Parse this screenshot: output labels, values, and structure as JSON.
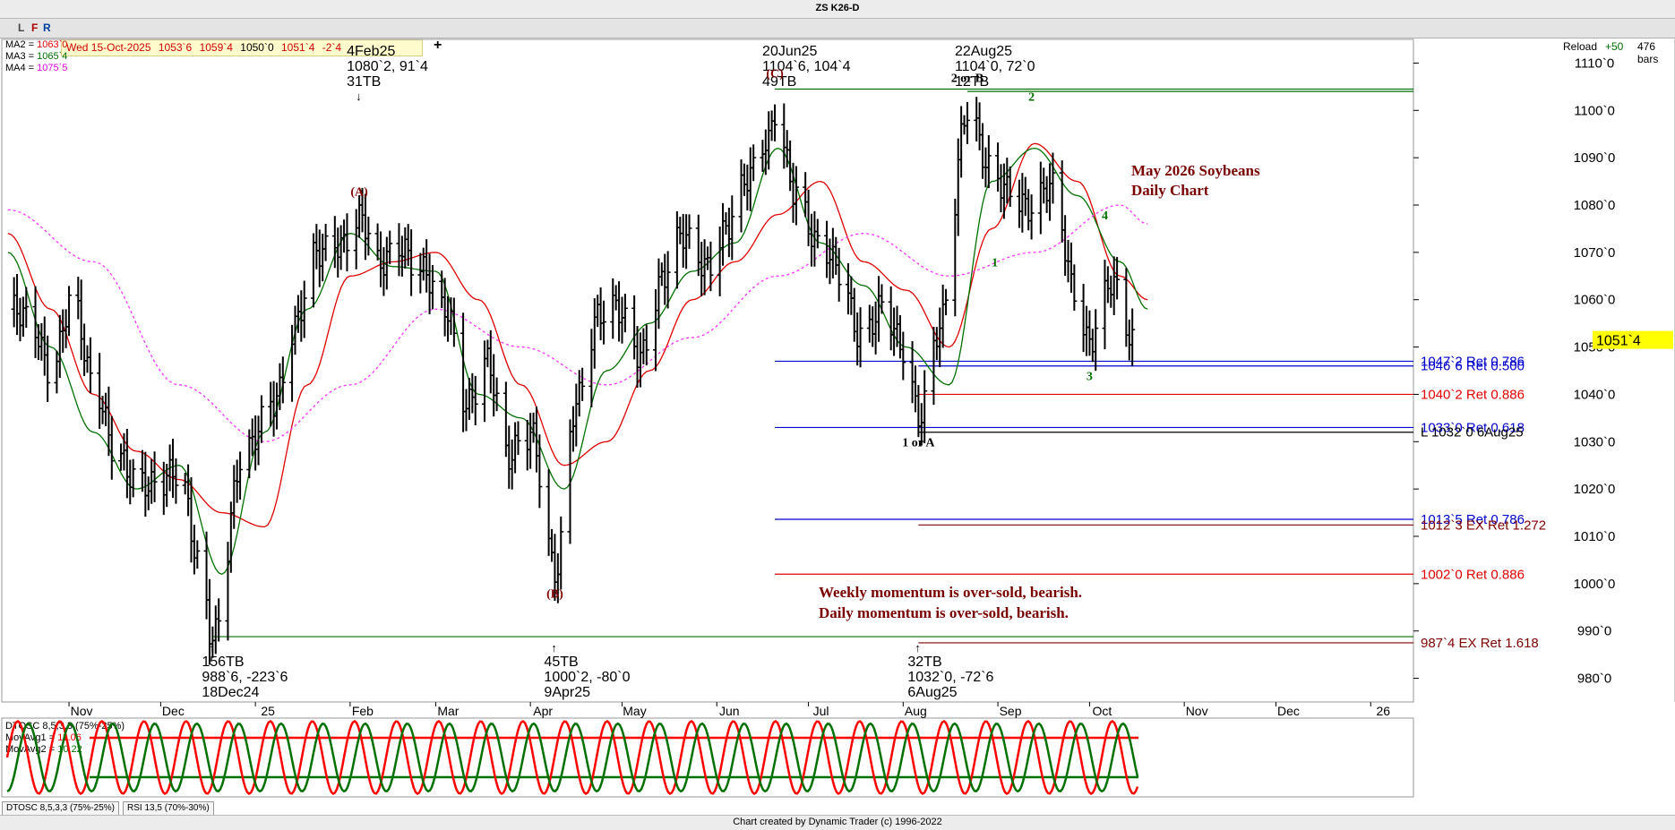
{
  "title": "ZS K26-D",
  "toolbar": {
    "btn_l": "L",
    "btn_f": "F",
    "btn_r": "R",
    "date": "Wed 15-Oct-2025",
    "open": "1053`6",
    "high": "1059`4",
    "low": "1050`0",
    "close": "1051`4",
    "change": "-2`4",
    "plus": "+",
    "reload": "Reload",
    "plus50": "+50",
    "bars": "476 bars"
  },
  "ma_legend": [
    {
      "name": "MA2",
      "value": "1063`0",
      "color": "#e00000"
    },
    {
      "name": "MA3",
      "value": "1065`4",
      "color": "#007000"
    },
    {
      "name": "MA4",
      "value": "1075`5",
      "color": "#e000e0"
    }
  ],
  "colors": {
    "bars": "#000000",
    "ma_fast": "#e00000",
    "ma_mid": "#007000",
    "ma_slow": "#ff33ff",
    "ret_blue": "#0000cc",
    "ret_red": "#e00000",
    "ret_maroon": "#800000",
    "ret_green": "#007000",
    "note": "#7a0000",
    "osc_red": "#ff0000",
    "osc_green": "#007000"
  },
  "chart_data": {
    "type": "line",
    "ylim": [
      975,
      1115
    ],
    "y_ticks": [
      980,
      990,
      1000,
      1010,
      1020,
      1030,
      1040,
      1050,
      1060,
      1070,
      1080,
      1090,
      1100,
      1110
    ],
    "y_tick_labels": [
      "980`0",
      "990`0",
      "1000`0",
      "1010`0",
      "1020`0",
      "1030`0",
      "1040`0",
      "1050`0",
      "1060`0",
      "1070`0",
      "1080`0",
      "1090`0",
      "1100`0",
      "1110`0"
    ],
    "x_range": [
      "2024-10-10",
      "2026-01-15"
    ],
    "month_ticks": [
      {
        "date": "2024-11-01",
        "label": "Nov"
      },
      {
        "date": "2024-12-01",
        "label": "Dec"
      },
      {
        "date": "2025-01-01",
        "label": "25"
      },
      {
        "date": "2025-02-01",
        "label": "Feb"
      },
      {
        "date": "2025-03-01",
        "label": "Mar"
      },
      {
        "date": "2025-04-01",
        "label": "Apr"
      },
      {
        "date": "2025-05-01",
        "label": "May"
      },
      {
        "date": "2025-06-01",
        "label": "Jun"
      },
      {
        "date": "2025-07-01",
        "label": "Jul"
      },
      {
        "date": "2025-08-01",
        "label": "Aug"
      },
      {
        "date": "2025-09-01",
        "label": "Sep"
      },
      {
        "date": "2025-10-01",
        "label": "Oct"
      },
      {
        "date": "2025-11-01",
        "label": "Nov"
      },
      {
        "date": "2025-12-01",
        "label": "Dec"
      },
      {
        "date": "2026-01-01",
        "label": "26"
      }
    ],
    "series": [
      {
        "color": "#000000",
        "style": "ohlc-bars",
        "x": [
          "2024-10-12",
          "2024-10-19",
          "2024-10-26",
          "2024-11-02",
          "2024-11-09",
          "2024-11-16",
          "2024-11-23",
          "2024-11-30",
          "2024-12-07",
          "2024-12-14",
          "2024-12-18",
          "2024-12-28",
          "2025-01-07",
          "2025-01-14",
          "2025-01-21",
          "2025-01-28",
          "2025-02-04",
          "2025-02-11",
          "2025-02-18",
          "2025-02-25",
          "2025-03-04",
          "2025-03-11",
          "2025-03-18",
          "2025-03-25",
          "2025-04-01",
          "2025-04-09",
          "2025-04-16",
          "2025-04-23",
          "2025-04-30",
          "2025-05-07",
          "2025-05-14",
          "2025-05-21",
          "2025-05-28",
          "2025-06-04",
          "2025-06-11",
          "2025-06-18",
          "2025-06-20",
          "2025-06-27",
          "2025-07-04",
          "2025-07-11",
          "2025-07-18",
          "2025-07-25",
          "2025-08-01",
          "2025-08-06",
          "2025-08-13",
          "2025-08-22",
          "2025-08-29",
          "2025-09-05",
          "2025-09-12",
          "2025-09-19",
          "2025-09-26",
          "2025-10-01",
          "2025-10-08",
          "2025-10-15"
        ],
        "y": [
          1058,
          1054,
          1046,
          1062,
          1040,
          1028,
          1024,
          1020,
          1022,
          1005,
          990,
          1025,
          1040,
          1055,
          1068,
          1072,
          1079,
          1066,
          1070,
          1068,
          1058,
          1036,
          1048,
          1028,
          1030,
          1003,
          1040,
          1055,
          1057,
          1050,
          1064,
          1072,
          1068,
          1076,
          1084,
          1093,
          1101,
          1084,
          1070,
          1066,
          1054,
          1058,
          1048,
          1036,
          1056,
          1098,
          1088,
          1085,
          1078,
          1083,
          1064,
          1052,
          1062,
          1051
        ]
      },
      {
        "color": "#e00000",
        "style": "ma-fast",
        "x": [
          "2024-10-12",
          "2024-10-26",
          "2024-11-09",
          "2024-11-23",
          "2024-12-07",
          "2024-12-21",
          "2025-01-04",
          "2025-01-18",
          "2025-02-01",
          "2025-02-15",
          "2025-03-01",
          "2025-03-15",
          "2025-03-29",
          "2025-04-12",
          "2025-04-26",
          "2025-05-10",
          "2025-05-24",
          "2025-06-07",
          "2025-06-21",
          "2025-07-05",
          "2025-07-19",
          "2025-08-02",
          "2025-08-16",
          "2025-08-30",
          "2025-09-13",
          "2025-09-27",
          "2025-10-11",
          "2025-10-20"
        ],
        "y": [
          1074,
          1058,
          1040,
          1028,
          1022,
          1015,
          1012,
          1042,
          1065,
          1068,
          1070,
          1060,
          1042,
          1025,
          1030,
          1045,
          1060,
          1068,
          1078,
          1085,
          1068,
          1062,
          1050,
          1075,
          1093,
          1085,
          1065,
          1060
        ]
      },
      {
        "color": "#007000",
        "style": "ma-mid",
        "x": [
          "2024-10-12",
          "2024-10-26",
          "2024-11-09",
          "2024-11-23",
          "2024-12-07",
          "2024-12-21",
          "2025-01-04",
          "2025-01-18",
          "2025-02-01",
          "2025-02-15",
          "2025-03-01",
          "2025-03-15",
          "2025-03-29",
          "2025-04-12",
          "2025-04-26",
          "2025-05-10",
          "2025-05-24",
          "2025-06-07",
          "2025-06-21",
          "2025-07-05",
          "2025-07-19",
          "2025-08-02",
          "2025-08-16",
          "2025-08-30",
          "2025-09-13",
          "2025-09-27",
          "2025-10-11",
          "2025-10-20"
        ],
        "y": [
          1070,
          1050,
          1032,
          1020,
          1025,
          1002,
          1032,
          1058,
          1074,
          1067,
          1066,
          1040,
          1035,
          1020,
          1045,
          1055,
          1066,
          1072,
          1092,
          1072,
          1063,
          1050,
          1042,
          1085,
          1092,
          1082,
          1068,
          1058
        ]
      },
      {
        "color": "#ff33ff",
        "style": "ma-slow",
        "x": [
          "2024-10-12",
          "2024-11-09",
          "2024-12-07",
          "2025-01-04",
          "2025-02-01",
          "2025-03-01",
          "2025-03-29",
          "2025-04-26",
          "2025-05-24",
          "2025-06-21",
          "2025-07-19",
          "2025-08-16",
          "2025-09-13",
          "2025-10-11",
          "2025-10-20"
        ],
        "y": [
          1079,
          1068,
          1042,
          1030,
          1042,
          1058,
          1050,
          1042,
          1052,
          1065,
          1074,
          1065,
          1070,
          1080,
          1076
        ]
      }
    ],
    "pivots": [
      {
        "x": "2025-02-04",
        "lines": [
          "4Feb25",
          "1080`2, 91`4",
          "31TB"
        ],
        "arrow": "↓",
        "position": "above"
      },
      {
        "x": "2025-06-20",
        "lines": [
          "20Jun25",
          "1104`6, 104`4",
          "49TB"
        ],
        "arrow": "",
        "position": "above"
      },
      {
        "x": "2025-08-22",
        "lines": [
          "22Aug25",
          "1104`0, 72`0",
          "12TB"
        ],
        "arrow": "",
        "position": "above"
      },
      {
        "x": "2024-12-18",
        "lines": [
          "156TB",
          "988`6, -223`6",
          "18Dec24"
        ],
        "arrow": "↑",
        "position": "below"
      },
      {
        "x": "2025-04-09",
        "lines": [
          "45TB",
          "1000`2, -80`0",
          "9Apr25"
        ],
        "arrow": "↑",
        "position": "below"
      },
      {
        "x": "2025-08-06",
        "lines": [
          "32TB",
          "1032`0, -72`6",
          "6Aug25"
        ],
        "arrow": "↑",
        "position": "below"
      }
    ],
    "wave_labels": [
      {
        "text": "(A)",
        "x": "2025-02-04",
        "y": 1082,
        "color": "#800000"
      },
      {
        "text": "(B)",
        "x": "2025-04-09",
        "y": 997,
        "color": "#800000"
      },
      {
        "text": "(C)",
        "x": "2025-06-20",
        "y": 1107,
        "color": "#800000"
      },
      {
        "text": "2 or B",
        "x": "2025-08-22",
        "y": 1106,
        "color": "#000000"
      },
      {
        "text": "1 or A",
        "x": "2025-08-06",
        "y": 1029,
        "color": "#000000"
      },
      {
        "text": "1",
        "x": "2025-08-31",
        "y": 1067,
        "color": "#007000"
      },
      {
        "text": "2",
        "x": "2025-09-12",
        "y": 1102,
        "color": "#007000"
      },
      {
        "text": "3",
        "x": "2025-10-01",
        "y": 1043,
        "color": "#007000"
      },
      {
        "text": "4",
        "x": "2025-10-06",
        "y": 1077,
        "color": "#007000"
      }
    ],
    "levels": [
      {
        "y": 1104.5,
        "label": "",
        "color": "#007000",
        "x_start": "2025-06-20"
      },
      {
        "y": 1104,
        "label": "",
        "color": "#007000",
        "x_start": "2025-08-22"
      },
      {
        "y": 1047,
        "label": "1047`2 Ret 0.786",
        "color": "#0000cc",
        "x_start": "2025-06-20"
      },
      {
        "y": 1046,
        "label": "1046`6 Ret 0.500",
        "color": "#0000cc",
        "x_start": "2025-08-06"
      },
      {
        "y": 1040,
        "label": "1040`2 Ret 0.886",
        "color": "#e00000",
        "x_start": "2025-08-06"
      },
      {
        "y": 1033,
        "label": "1033`0 Ret 0.618",
        "color": "#0000cc",
        "x_start": "2025-06-20"
      },
      {
        "y": 1032,
        "label": "L 1032`0 6Aug25",
        "color": "#000000",
        "x_start": "2025-08-06"
      },
      {
        "y": 1013.6,
        "label": "1013`5 Ret 0.786",
        "color": "#0000cc",
        "x_start": "2025-06-20"
      },
      {
        "y": 1012.4,
        "label": "1012`3 EX Ret 1.272",
        "color": "#800000",
        "x_start": "2025-08-06"
      },
      {
        "y": 1002,
        "label": "1002`0 Ret 0.886",
        "color": "#e00000",
        "x_start": "2025-06-20"
      },
      {
        "y": 988.8,
        "label": "",
        "color": "#007000",
        "x_start": "2024-12-18"
      },
      {
        "y": 987.5,
        "label": "987`4 EX Ret 1.618",
        "color": "#800000",
        "x_start": "2025-08-06"
      }
    ],
    "notes": {
      "title_line1": "May 2026 Soybeans",
      "title_line2": "Daily Chart",
      "momentum_line1": "Weekly momentum is over-sold, bearish.",
      "momentum_line2": "Daily momentum is over-sold, bearish."
    },
    "last_price": {
      "value": 1051.5,
      "label": "1051`4"
    },
    "oscillator": {
      "label": "DTOSC 8,5,3,3 (75%-25%)",
      "mov1_label": "MovAvg1 = ",
      "mov1_value": "11.06",
      "mov2_label": "MovAvg2 = ",
      "mov2_value": "10.22",
      "upper": 75,
      "lower": 25,
      "fast_color": "#ff0000",
      "slow_color": "#007000"
    }
  },
  "tabs": [
    "DTOSC 8,5,3,3 (75%-25%)",
    "RSI 13,5 (70%-30%)"
  ],
  "footer": "Chart created by Dynamic Trader  (c) 1996-2022"
}
